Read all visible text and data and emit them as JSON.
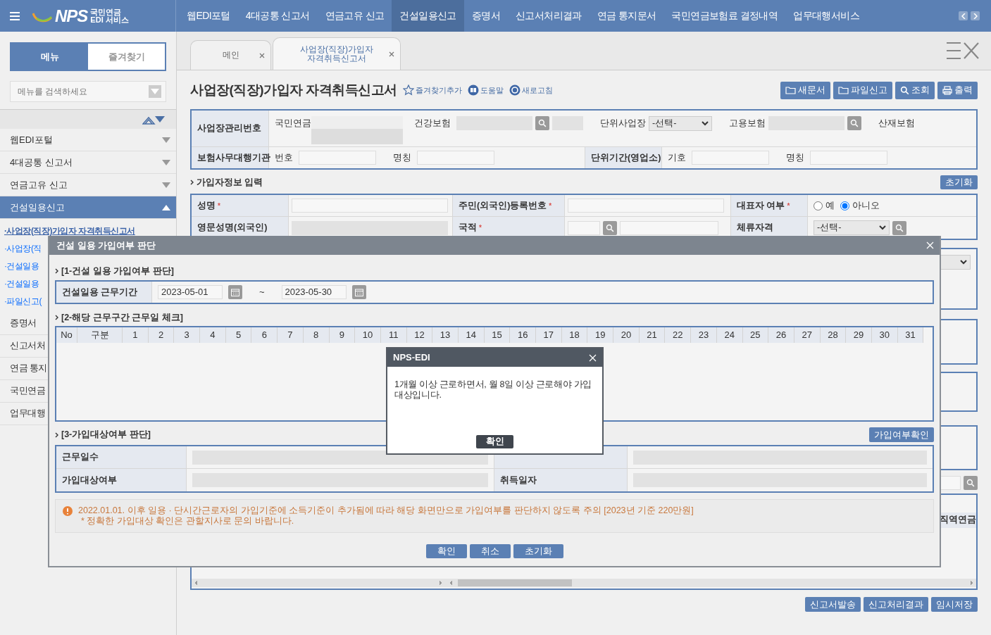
{
  "top_nav": {
    "logo_text": "NPS",
    "logo_line_1": "국민연금",
    "logo_line_2": "EDI 서비스",
    "items": [
      {
        "label": "웹EDI포털",
        "selected": false
      },
      {
        "label": "4대공통 신고서",
        "selected": false
      },
      {
        "label": "연금고유 신고",
        "selected": false
      },
      {
        "label": "건설일용신고",
        "selected": true
      },
      {
        "label": "증명서",
        "selected": false
      },
      {
        "label": "신고서처리결과",
        "selected": false
      },
      {
        "label": "연금 통지문서",
        "selected": false
      },
      {
        "label": "국민연금보험료 결정내역",
        "selected": false
      },
      {
        "label": "업무대행서비스",
        "selected": false
      }
    ]
  },
  "sidebar": {
    "tabs": [
      {
        "label": "메뉴",
        "selected": true
      },
      {
        "label": "즐겨찾기",
        "selected": false
      }
    ],
    "search": {
      "placeholder": "메뉴를 검색하세요"
    },
    "items": [
      {
        "label": "웹EDI포털",
        "expanded": false
      },
      {
        "label": "4대공통 신고서",
        "expanded": false
      },
      {
        "label": "연금고유 신고",
        "expanded": false
      },
      {
        "label": "건설일용신고",
        "expanded": true,
        "children": [
          {
            "label": "·사업장(직장)가입자 자격취득신고서",
            "selected": true
          },
          {
            "label": "·사업장(직",
            "selected": false
          },
          {
            "label": "·건설일용",
            "selected": false
          },
          {
            "label": "·건설일용",
            "selected": false
          },
          {
            "label": "·파일신고(",
            "selected": false
          }
        ]
      },
      {
        "label": "증명서"
      },
      {
        "label": "신고서처"
      },
      {
        "label": "연금 통지"
      },
      {
        "label": "국민연금"
      },
      {
        "label": "업무대행"
      }
    ]
  },
  "doc_tabs": [
    {
      "label": "메인",
      "selected": false
    },
    {
      "label": "사업장(직장)가입자\n자격취득신고서",
      "selected": true
    }
  ],
  "page": {
    "title": "사업장(직장)가입자 자격취득신고서",
    "links": [
      {
        "label": "즐겨찾기추가",
        "kind": "star"
      },
      {
        "label": "도움말",
        "kind": "book"
      },
      {
        "label": "새로고침",
        "kind": "refresh"
      }
    ],
    "buttons": [
      {
        "label": "새문서",
        "kind": "folder"
      },
      {
        "label": "파일신고",
        "kind": "folder"
      },
      {
        "label": "조회",
        "kind": "search"
      },
      {
        "label": "출력",
        "kind": "print"
      }
    ]
  },
  "workplace": {
    "label": "사업장관리번호",
    "pension_label": "국민연금",
    "health_label": "건강보험",
    "unit_label": "단위사업장",
    "unit_select": "-선택-",
    "employment_label": "고용보험",
    "accident_label": "산재보험",
    "agency_label": "보험사무대행기관",
    "agency_no_label": "번호",
    "agency_name_label": "명칭",
    "unit_period_label": "단위기간(영업소)",
    "symbol_label": "기호",
    "name_label": "명칭"
  },
  "member": {
    "title": "가입자정보 입력",
    "reset_button": "초기화",
    "name_label": {
      "text": "성명",
      "mark": "*"
    },
    "rrn_label": {
      "text": "주민(외국인)등록번호",
      "mark": "*"
    },
    "rep_label": {
      "text": "대표자 여부",
      "mark": "*"
    },
    "rep_options": [
      {
        "label": "예",
        "selected": false
      },
      {
        "label": "아니오",
        "selected": true
      }
    ],
    "eng_name_label": {
      "text": "영문성명(외국인)"
    },
    "nationality_label": {
      "text": "국적",
      "mark": "*"
    },
    "stay_label": {
      "text": "체류자격"
    },
    "stay_select": "-선택-"
  },
  "grid_header_fragment": "직역연금",
  "bottom_buttons": [
    "신고서발송",
    "신고처리결과",
    "임시저장"
  ],
  "modal": {
    "title": "건설 일용 가입여부 판단",
    "section_1": "[1-건설 일용 가입여부 판단]",
    "period_label": "건설일용 근무기간",
    "start_date": "2023-05-01",
    "separator": "~",
    "end_date": "2023-05-30",
    "section_2": "[2-해당 근무구간 근무일 체크]",
    "day_columns": [
      "No",
      "구분",
      "1",
      "2",
      "3",
      "4",
      "5",
      "6",
      "7",
      "8",
      "9",
      "10",
      "11",
      "12",
      "13",
      "14",
      "15",
      "16",
      "17",
      "18",
      "19",
      "20",
      "21",
      "22",
      "23",
      "24",
      "25",
      "26",
      "27",
      "28",
      "29",
      "30",
      "31"
    ],
    "section_3": "[3-가입대상여부 판단]",
    "check_button": "가입여부확인",
    "result_rows": [
      {
        "left_label": "근무일수"
      },
      {
        "left_label": "가입대상여부",
        "right_label": "취득일자"
      }
    ],
    "notice": [
      "2022.01.01. 이후 일용 · 단시간근로자의 가입기준에 소득기준이 추가됨에 따라 해당 화면만으로 가입여부를 판단하지 않도록 주의 [2023년 기준 220만원]",
      "* 정확한 가입대상 확인은 관할지사로 문의 바랍니다."
    ],
    "buttons": [
      "확인",
      "취소",
      "초기화"
    ]
  },
  "alert": {
    "title": "NPS-EDI",
    "message": "1개월 이상 근로하면서, 월 8일 이상 근로해야 가입대상입니다.",
    "button": "확인"
  }
}
